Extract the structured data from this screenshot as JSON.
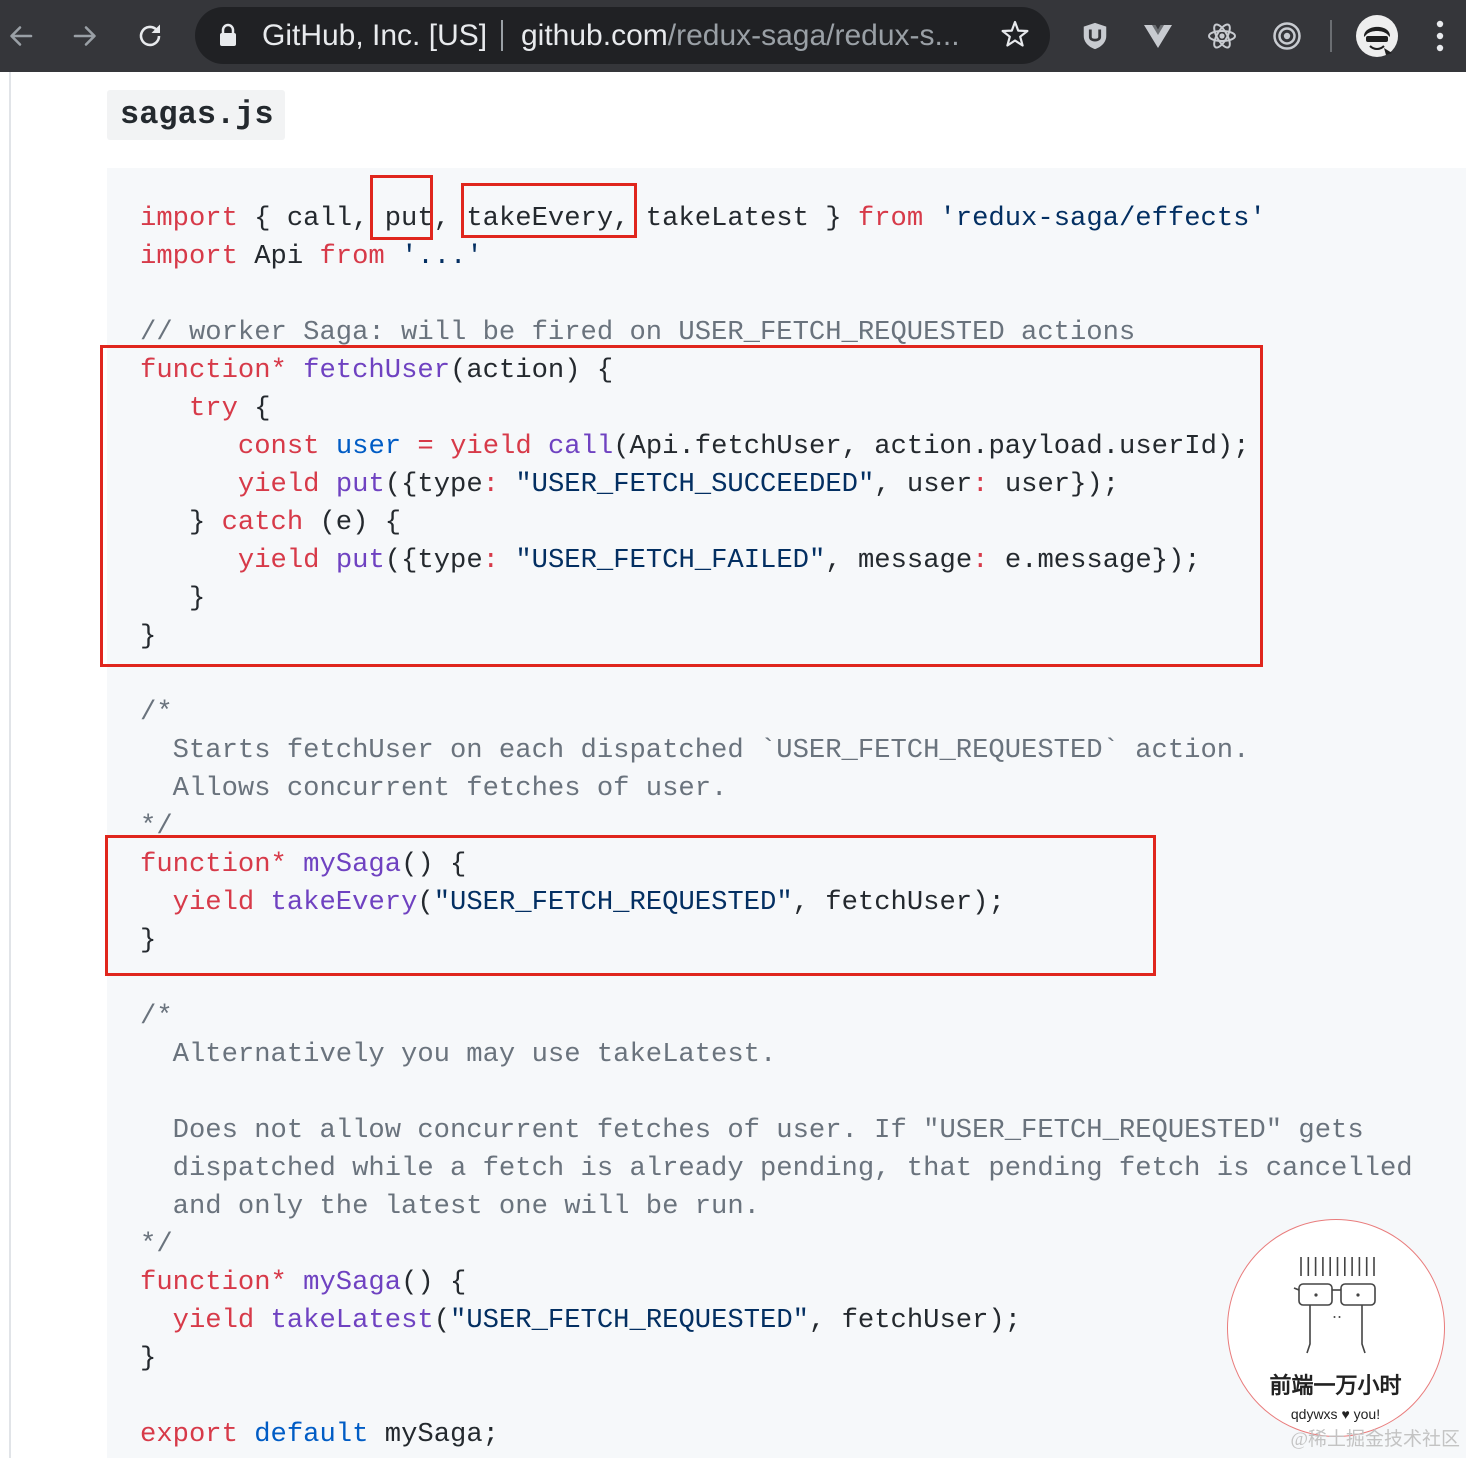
{
  "browser": {
    "site_identity": "GitHub, Inc. [US]",
    "url_host": "github.com",
    "url_path": "/redux-saga/redux-s...",
    "icons": {
      "back": "back-arrow-icon",
      "forward": "forward-arrow-icon",
      "reload": "reload-icon",
      "secure": "lock-icon",
      "bookmark": "star-icon",
      "extensions": [
        "shield-extension-icon",
        "vue-devtools-icon",
        "react-devtools-icon",
        "target-extension-icon"
      ],
      "profile": "avatar-icon",
      "menu": "kebab-menu-icon"
    }
  },
  "file": {
    "name": "sagas.js"
  },
  "syntax_colors": {
    "keyword": "#d73a49",
    "entity": "#6f42c1",
    "string": "#032f62",
    "constant": "#005cc5",
    "comment": "#6a737d",
    "plain": "#24292e"
  },
  "code": {
    "lines": [
      [
        [
          "keyword",
          "import"
        ],
        [
          "plain",
          " { call, put, takeEvery, takeLatest } "
        ],
        [
          "keyword",
          "from"
        ],
        [
          "plain",
          " "
        ],
        [
          "string",
          "'redux-saga/effects'"
        ]
      ],
      [
        [
          "keyword",
          "import"
        ],
        [
          "plain",
          " Api "
        ],
        [
          "keyword",
          "from"
        ],
        [
          "plain",
          " "
        ],
        [
          "string",
          "'...'"
        ]
      ],
      [],
      [
        [
          "comment",
          "// worker Saga: will be fired on USER_FETCH_REQUESTED actions"
        ]
      ],
      [
        [
          "keyword",
          "function*"
        ],
        [
          "plain",
          " "
        ],
        [
          "entity",
          "fetchUser"
        ],
        [
          "plain",
          "(action) {"
        ]
      ],
      [
        [
          "plain",
          "   "
        ],
        [
          "keyword",
          "try"
        ],
        [
          "plain",
          " {"
        ]
      ],
      [
        [
          "plain",
          "      "
        ],
        [
          "keyword",
          "const"
        ],
        [
          "plain",
          " "
        ],
        [
          "constant",
          "user"
        ],
        [
          "plain",
          " "
        ],
        [
          "keyword",
          "="
        ],
        [
          "plain",
          " "
        ],
        [
          "keyword",
          "yield"
        ],
        [
          "plain",
          " "
        ],
        [
          "entity",
          "call"
        ],
        [
          "plain",
          "(Api.fetchUser, action.payload.userId);"
        ]
      ],
      [
        [
          "plain",
          "      "
        ],
        [
          "keyword",
          "yield"
        ],
        [
          "plain",
          " "
        ],
        [
          "entity",
          "put"
        ],
        [
          "plain",
          "({type"
        ],
        [
          "keyword",
          ":"
        ],
        [
          "plain",
          " "
        ],
        [
          "string",
          "\"USER_FETCH_SUCCEEDED\""
        ],
        [
          "plain",
          ", user"
        ],
        [
          "keyword",
          ":"
        ],
        [
          "plain",
          " user});"
        ]
      ],
      [
        [
          "plain",
          "   } "
        ],
        [
          "keyword",
          "catch"
        ],
        [
          "plain",
          " (e) {"
        ]
      ],
      [
        [
          "plain",
          "      "
        ],
        [
          "keyword",
          "yield"
        ],
        [
          "plain",
          " "
        ],
        [
          "entity",
          "put"
        ],
        [
          "plain",
          "({type"
        ],
        [
          "keyword",
          ":"
        ],
        [
          "plain",
          " "
        ],
        [
          "string",
          "\"USER_FETCH_FAILED\""
        ],
        [
          "plain",
          ", message"
        ],
        [
          "keyword",
          ":"
        ],
        [
          "plain",
          " e.message});"
        ]
      ],
      [
        [
          "plain",
          "   }"
        ]
      ],
      [
        [
          "plain",
          "}"
        ]
      ],
      [],
      [
        [
          "comment",
          "/*"
        ]
      ],
      [
        [
          "comment",
          "  Starts fetchUser on each dispatched `USER_FETCH_REQUESTED` action."
        ]
      ],
      [
        [
          "comment",
          "  Allows concurrent fetches of user."
        ]
      ],
      [
        [
          "comment",
          "*/"
        ]
      ],
      [
        [
          "keyword",
          "function*"
        ],
        [
          "plain",
          " "
        ],
        [
          "entity",
          "mySaga"
        ],
        [
          "plain",
          "() {"
        ]
      ],
      [
        [
          "plain",
          "  "
        ],
        [
          "keyword",
          "yield"
        ],
        [
          "plain",
          " "
        ],
        [
          "entity",
          "takeEvery"
        ],
        [
          "plain",
          "("
        ],
        [
          "string",
          "\"USER_FETCH_REQUESTED\""
        ],
        [
          "plain",
          ", fetchUser);"
        ]
      ],
      [
        [
          "plain",
          "}"
        ]
      ],
      [],
      [
        [
          "comment",
          "/*"
        ]
      ],
      [
        [
          "comment",
          "  Alternatively you may use takeLatest."
        ]
      ],
      [],
      [
        [
          "comment",
          "  Does not allow concurrent fetches of user. If \"USER_FETCH_REQUESTED\" gets"
        ]
      ],
      [
        [
          "comment",
          "  dispatched while a fetch is already pending, that pending fetch is cancelled"
        ]
      ],
      [
        [
          "comment",
          "  and only the latest one will be run."
        ]
      ],
      [
        [
          "comment",
          "*/"
        ]
      ],
      [
        [
          "keyword",
          "function*"
        ],
        [
          "plain",
          " "
        ],
        [
          "entity",
          "mySaga"
        ],
        [
          "plain",
          "() {"
        ]
      ],
      [
        [
          "plain",
          "  "
        ],
        [
          "keyword",
          "yield"
        ],
        [
          "plain",
          " "
        ],
        [
          "entity",
          "takeLatest"
        ],
        [
          "plain",
          "("
        ],
        [
          "string",
          "\"USER_FETCH_REQUESTED\""
        ],
        [
          "plain",
          ", fetchUser);"
        ]
      ],
      [
        [
          "plain",
          "}"
        ]
      ],
      [],
      [
        [
          "keyword",
          "export"
        ],
        [
          "plain",
          " "
        ],
        [
          "constant",
          "default"
        ],
        [
          "plain",
          " mySaga;"
        ]
      ]
    ]
  },
  "annotation_color": "#e0261d",
  "watermark": {
    "title": "前端一万小时",
    "tagline": "qdywxs ♥ you!"
  },
  "source_mark": "@稀土掘金技术社区"
}
